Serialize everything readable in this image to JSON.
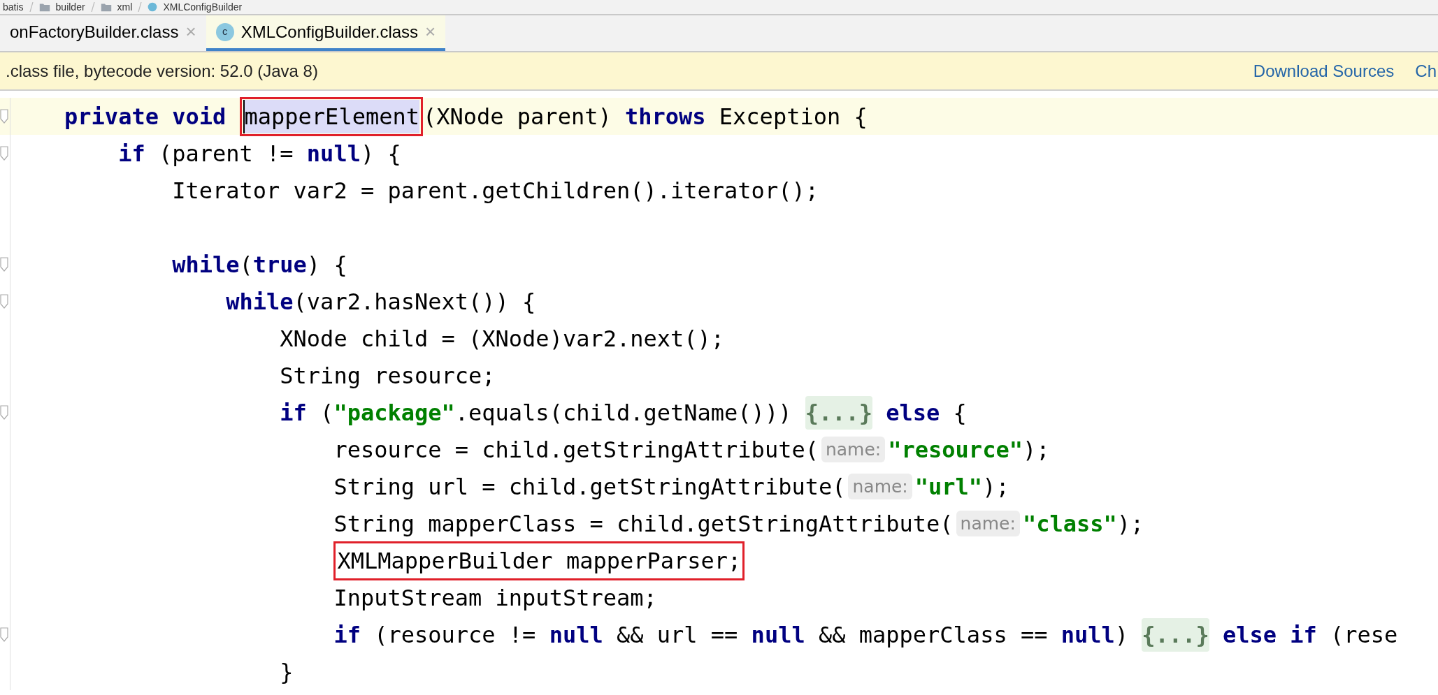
{
  "breadcrumbs": [
    "batis",
    "builder",
    "xml",
    "XMLConfigBuilder"
  ],
  "tabs": [
    {
      "label": "onFactoryBuilder.class",
      "selected": false,
      "close": "×"
    },
    {
      "label": "XMLConfigBuilder.class",
      "selected": true,
      "close": "×",
      "icon_letter": "c"
    }
  ],
  "notification": {
    "text": ".class file, bytecode version: 52.0 (Java 8)",
    "links": [
      "Download Sources",
      "Ch"
    ]
  },
  "code": {
    "lines": [
      {
        "current": true,
        "fold": true,
        "segments": [
          {
            "kind": "keyword",
            "text": "    private void "
          },
          {
            "kind": "selection",
            "text": "mapperElement",
            "boxed": true
          },
          {
            "kind": "plain",
            "text": "(XNode parent) "
          },
          {
            "kind": "keyword",
            "text": "throws "
          },
          {
            "kind": "plain",
            "text": "Exception {"
          }
        ]
      },
      {
        "current": false,
        "fold": true,
        "segments": [
          {
            "kind": "keyword",
            "text": "        if "
          },
          {
            "kind": "plain",
            "text": "(parent != "
          },
          {
            "kind": "keyword",
            "text": "null"
          },
          {
            "kind": "plain",
            "text": ") {"
          }
        ]
      },
      {
        "current": false,
        "fold": false,
        "segments": [
          {
            "kind": "plain",
            "text": "            Iterator var2 = parent.getChildren().iterator();"
          }
        ]
      },
      {
        "current": false,
        "fold": false
      },
      {
        "current": false,
        "fold": true,
        "segments": [
          {
            "kind": "keyword",
            "text": "            while"
          },
          {
            "kind": "plain",
            "text": "("
          },
          {
            "kind": "keyword",
            "text": "true"
          },
          {
            "kind": "plain",
            "text": ") {"
          }
        ]
      },
      {
        "current": false,
        "fold": true,
        "segments": [
          {
            "kind": "keyword",
            "text": "                while"
          },
          {
            "kind": "plain",
            "text": "(var2.hasNext()) {"
          }
        ]
      },
      {
        "current": false,
        "fold": false,
        "segments": [
          {
            "kind": "plain",
            "text": "                    XNode child = (XNode)var2.next();"
          }
        ]
      },
      {
        "current": false,
        "fold": false,
        "segments": [
          {
            "kind": "plain",
            "text": "                    String resource;"
          }
        ]
      },
      {
        "current": false,
        "fold": true,
        "segments": [
          {
            "kind": "keyword",
            "text": "                    if "
          },
          {
            "kind": "plain",
            "text": "("
          },
          {
            "kind": "string",
            "text": "\"package\""
          },
          {
            "kind": "plain",
            "text": ".equals(child.getName())) "
          },
          {
            "kind": "folded",
            "text": "{...}"
          },
          {
            "kind": "keyword",
            "text": " else "
          },
          {
            "kind": "plain",
            "text": "{"
          }
        ]
      },
      {
        "current": false,
        "fold": false,
        "segments": [
          {
            "kind": "plain",
            "text": "                        resource = child.getStringAttribute("
          },
          {
            "kind": "hint",
            "text": "name:"
          },
          {
            "kind": "string",
            "text": "\"resource\""
          },
          {
            "kind": "plain",
            "text": ");"
          }
        ]
      },
      {
        "current": false,
        "fold": false,
        "segments": [
          {
            "kind": "plain",
            "text": "                        String url = child.getStringAttribute("
          },
          {
            "kind": "hint",
            "text": "name:"
          },
          {
            "kind": "string",
            "text": "\"url\""
          },
          {
            "kind": "plain",
            "text": ");"
          }
        ]
      },
      {
        "current": false,
        "fold": false,
        "segments": [
          {
            "kind": "plain",
            "text": "                        String mapperClass = child.getStringAttribute("
          },
          {
            "kind": "hint",
            "text": "name:"
          },
          {
            "kind": "string",
            "text": "\"class\""
          },
          {
            "kind": "plain",
            "text": ");"
          }
        ]
      },
      {
        "current": false,
        "fold": false,
        "segments": [
          {
            "kind": "plain",
            "text": "                        XMLMapperBuilder mapperParser;",
            "boxed": true
          }
        ]
      },
      {
        "current": false,
        "fold": false,
        "segments": [
          {
            "kind": "plain",
            "text": "                        InputStream inputStream;"
          }
        ]
      },
      {
        "current": false,
        "fold": true,
        "segments": [
          {
            "kind": "keyword",
            "text": "                        if "
          },
          {
            "kind": "plain",
            "text": "(resource != "
          },
          {
            "kind": "keyword",
            "text": "null "
          },
          {
            "kind": "plain",
            "text": "&& url == "
          },
          {
            "kind": "keyword",
            "text": "null "
          },
          {
            "kind": "plain",
            "text": "&& mapperClass == "
          },
          {
            "kind": "keyword",
            "text": "null"
          },
          {
            "kind": "plain",
            "text": ") "
          },
          {
            "kind": "folded",
            "text": "{...}"
          },
          {
            "kind": "keyword",
            "text": " else if "
          },
          {
            "kind": "plain",
            "text": "(rese"
          }
        ]
      },
      {
        "current": false,
        "fold": false,
        "segments": [
          {
            "kind": "plain",
            "text": "                    }"
          }
        ]
      }
    ]
  }
}
